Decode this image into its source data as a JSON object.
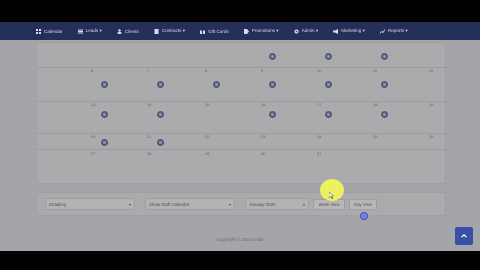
{
  "nav": {
    "items": [
      {
        "label": "Calendar",
        "icon": "grid-icon"
      },
      {
        "label": "Leads ▾",
        "icon": "list-icon"
      },
      {
        "label": "Clients",
        "icon": "user-icon"
      },
      {
        "label": "Contracts ▾",
        "icon": "file-icon"
      },
      {
        "label": "Gift Cards",
        "icon": "gift-icon"
      },
      {
        "label": "Promotions ▾",
        "icon": "tag-icon"
      },
      {
        "label": "Admin ▾",
        "icon": "gear-icon"
      },
      {
        "label": "Marketing ▾",
        "icon": "megaphone-icon"
      },
      {
        "label": "Reports ▾",
        "icon": "chart-icon"
      }
    ],
    "color": "#25305a"
  },
  "calendar": {
    "day_numbers_row1": [
      "6",
      "7",
      "8",
      "9",
      "10",
      "11",
      "12"
    ],
    "day_numbers_row2": [
      "13",
      "14",
      "15",
      "16",
      "17",
      "18",
      "19"
    ],
    "day_numbers_row3": [
      "20",
      "21",
      "22",
      "23",
      "24",
      "25",
      "26"
    ],
    "day_numbers_row4": [
      "27",
      "28",
      "29",
      "30",
      "31"
    ]
  },
  "controls": {
    "select1": "Detailing",
    "select2": "Show Staff Calendar",
    "select3": "January 2020",
    "week_button": "Week View",
    "day_button": "Day View"
  },
  "footer": {
    "copyright": "Copyright © 2020 Detail"
  }
}
